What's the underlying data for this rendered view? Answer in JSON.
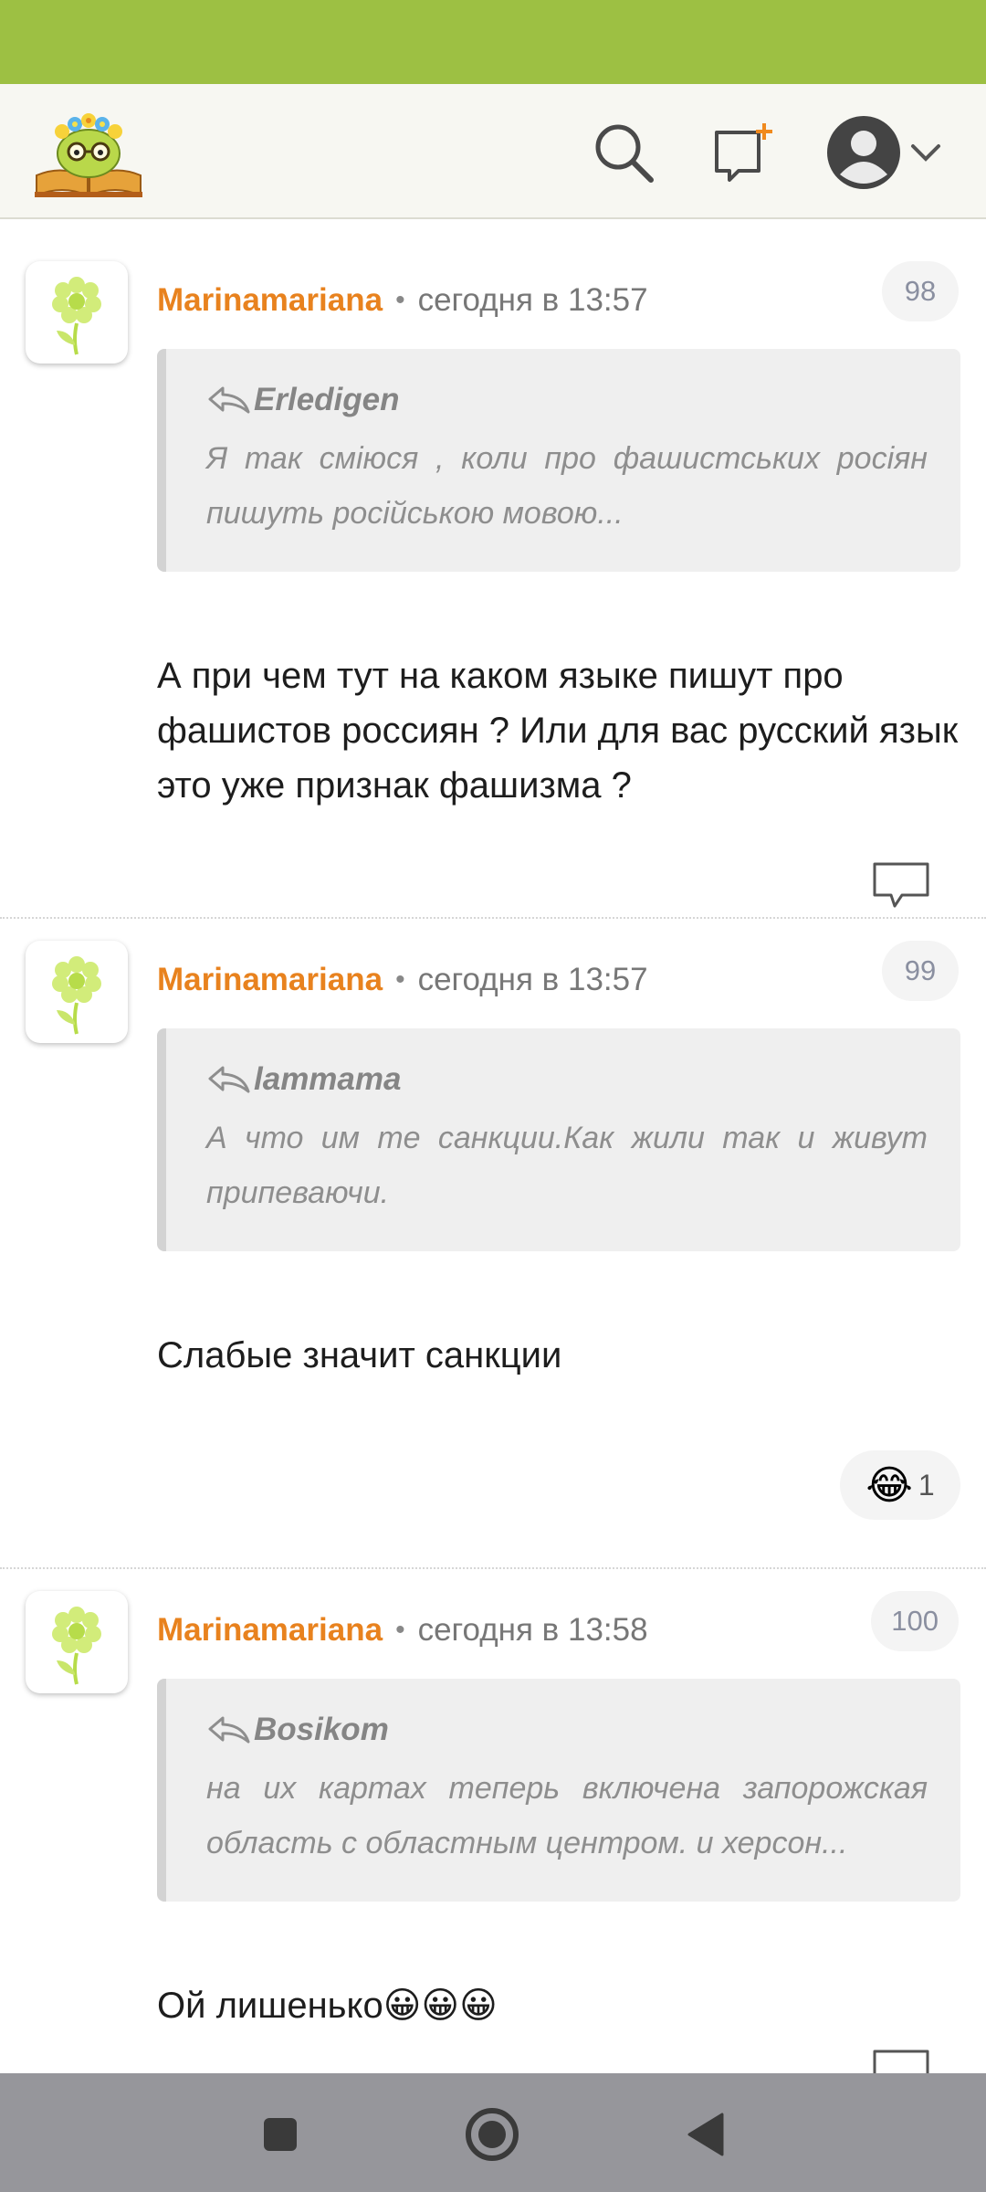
{
  "colors": {
    "status_bar": "#9dc043",
    "author": "#e8821e",
    "header_bg": "#f7f7f2",
    "nav_bar": "#96969b"
  },
  "header": {
    "logo": "site-logo-book-character",
    "icons": [
      "search-icon",
      "new-post-icon",
      "profile-icon",
      "chevron-down-icon"
    ]
  },
  "comments": [
    {
      "author": "Marinamariana",
      "dot": "•",
      "time": "сегодня в 13:57",
      "number": "98",
      "quote": {
        "author": "Erledigen",
        "text": "Я так сміюся , коли про фашистських росіян пишуть російською мовою..."
      },
      "body": "А при чем тут на каком языке пишут про фашистов россиян ? Или для вас русский язык это уже признак фашизма ?"
    },
    {
      "author": "Marinamariana",
      "dot": "•",
      "time": "сегодня в 13:57",
      "number": "99",
      "quote": {
        "author": "lammama",
        "text": "А что им те санкции.Как жили так и живут припеваючи."
      },
      "body": "Слабые значит санкции",
      "reaction": {
        "emoji": "😂",
        "count": "1"
      }
    },
    {
      "author": "Marinamariana",
      "dot": "•",
      "time": "сегодня в 13:58",
      "number": "100",
      "quote": {
        "author": "Bosikom",
        "text": "на их картах теперь включена запорожская область с областным центром. и херсон..."
      },
      "body": "Ой лишенько😀😀😀"
    }
  ],
  "nav": [
    "recents-square-icon",
    "home-circle-icon",
    "back-triangle-icon"
  ]
}
